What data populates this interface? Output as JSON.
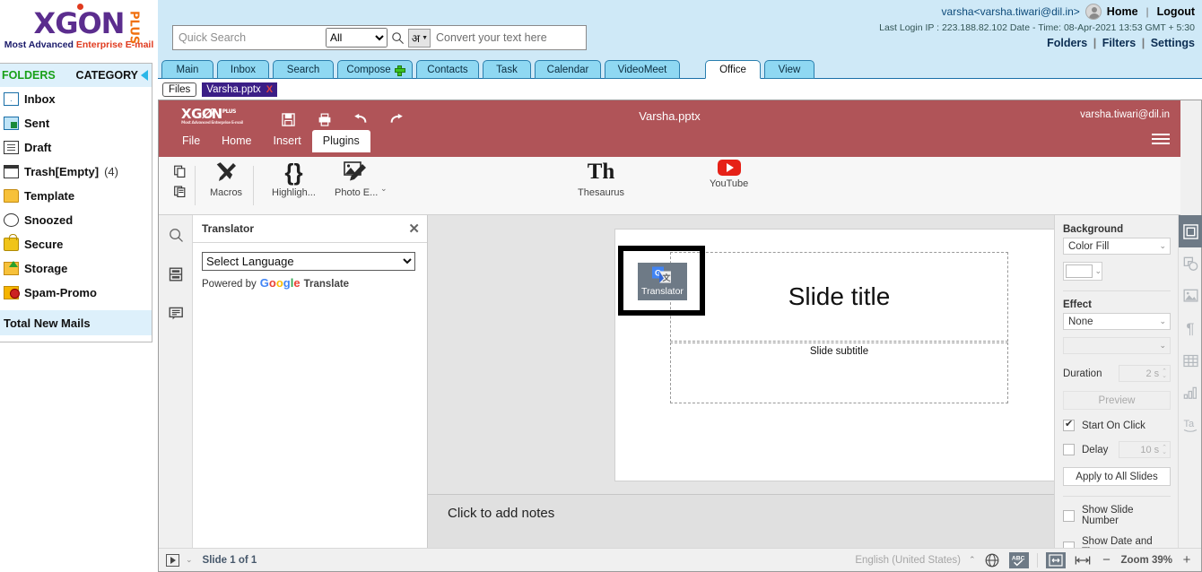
{
  "brand": {
    "logo_text": "XGON",
    "logo_plus": "PLUS",
    "tagline_1": "Most Advanced ",
    "tagline_2": "Enterprise E-mail"
  },
  "search": {
    "query_placeholder": "Quick Search",
    "query_value": "",
    "scope_selected": "All",
    "scope_options": [
      "All"
    ],
    "search_icon": "search-icon",
    "hindi_label": "अ",
    "convert_placeholder": "Convert your text here",
    "convert_value": ""
  },
  "account": {
    "user_display": "varsha<varsha.tiwari@dil.in>",
    "home_label": "Home",
    "logout_label": "Logout",
    "last_login": "Last Login IP : 223.188.82.102 Date - Time: 08-Apr-2021 13:53 GMT + 5:30",
    "folders_label": "Folders",
    "filters_label": "Filters",
    "settings_label": "Settings"
  },
  "main_tabs": [
    {
      "label": "Main",
      "active": false
    },
    {
      "label": "Inbox",
      "active": false
    },
    {
      "label": "Search",
      "active": false
    },
    {
      "label": "Compose",
      "active": false,
      "icon": "plus-icon"
    },
    {
      "label": "Contacts",
      "active": false
    },
    {
      "label": "Task",
      "active": false
    },
    {
      "label": "Calendar",
      "active": false
    },
    {
      "label": "VideoMeet",
      "active": false
    },
    {
      "label": "Office",
      "active": true
    },
    {
      "label": "View",
      "active": false
    }
  ],
  "files_bar": {
    "files_label": "Files",
    "open_file": "Varsha.pptx",
    "close_label": "X"
  },
  "sidebar": {
    "header_folders": "FOLDERS",
    "header_category": "CATEGORY",
    "items": [
      {
        "label": "Inbox",
        "icon": "inbox-icon",
        "count": ""
      },
      {
        "label": "Sent",
        "icon": "sent-icon",
        "count": ""
      },
      {
        "label": "Draft",
        "icon": "draft-icon",
        "count": ""
      },
      {
        "label": "Trash[Empty]",
        "icon": "trash-icon",
        "count": "(4)"
      },
      {
        "label": "Template",
        "icon": "template-icon",
        "count": ""
      },
      {
        "label": "Snoozed",
        "icon": "snoozed-icon",
        "count": ""
      },
      {
        "label": "Secure",
        "icon": "secure-icon",
        "count": ""
      },
      {
        "label": "Storage",
        "icon": "storage-icon",
        "count": ""
      },
      {
        "label": "Spam-Promo",
        "icon": "spam-icon",
        "count": ""
      }
    ],
    "total_new_mails": "Total New Mails"
  },
  "office": {
    "doc_title": "Varsha.pptx",
    "user_email": "varsha.tiwari@dil.in",
    "quick_access": [
      "save-icon",
      "print-icon",
      "undo-icon",
      "redo-icon"
    ],
    "menu_tabs": [
      {
        "label": "File",
        "active": false
      },
      {
        "label": "Home",
        "active": false
      },
      {
        "label": "Insert",
        "active": false
      },
      {
        "label": "Plugins",
        "active": true
      }
    ],
    "ribbon_tools": [
      {
        "label": "Macros",
        "icon": "macros-icon"
      },
      {
        "label": "Highligh...",
        "icon": "highlight-code-icon"
      },
      {
        "label": "Photo E...",
        "icon": "photo-editor-icon",
        "has_caret": true
      },
      {
        "label": "Thesaurus",
        "icon": "thesaurus-icon"
      },
      {
        "label": "Translator",
        "icon": "google-translate-icon",
        "selected": true
      },
      {
        "label": "YouTube",
        "icon": "youtube-icon"
      }
    ],
    "left_rail": [
      "search-icon",
      "slides-icon",
      "comment-icon"
    ],
    "translator_panel": {
      "title": "Translator",
      "close_icon": "close-icon",
      "language_selected": "Select Language",
      "language_options": [
        "Select Language"
      ],
      "powered_by": "Powered by",
      "google_word": "Google",
      "translate_word": "Translate"
    },
    "slide": {
      "title": "Slide title",
      "subtitle": "Slide subtitle"
    },
    "notes_placeholder": "Click to add notes",
    "properties": {
      "background_label": "Background",
      "background_value": "Color Fill",
      "background_color": "#ffffff",
      "effect_label": "Effect",
      "effect_value": "None",
      "effect_sub_value": "",
      "duration_label": "Duration",
      "duration_value": "2 s",
      "preview_label": "Preview",
      "start_on_click_label": "Start On Click",
      "start_on_click_checked": true,
      "delay_label": "Delay",
      "delay_checked": false,
      "delay_value": "10 s",
      "apply_all_label": "Apply to All Slides",
      "show_slide_number_label": "Show Slide Number",
      "show_slide_number_checked": false,
      "show_date_time_label": "Show Date and Time",
      "show_date_time_checked": false
    },
    "right_rail": [
      {
        "icon": "slide-settings-icon",
        "active": true
      },
      {
        "icon": "shape-settings-icon",
        "active": false
      },
      {
        "icon": "image-settings-icon",
        "active": false
      },
      {
        "icon": "paragraph-settings-icon",
        "active": false
      },
      {
        "icon": "table-settings-icon",
        "active": false
      },
      {
        "icon": "chart-settings-icon",
        "active": false
      },
      {
        "icon": "text-art-settings-icon",
        "active": false
      }
    ],
    "status": {
      "play_icon": "start-slideshow-icon",
      "play_caret": "chevron-down-icon",
      "slide_count": "Slide 1 of 1",
      "language": "English (United States)",
      "language_caret": "chevron-up-icon",
      "globe_icon": "set-language-icon",
      "spellcheck_icon": "spellcheck-icon",
      "fit_slide_icon": "fit-to-slide-icon",
      "fit_width_icon": "fit-to-width-icon",
      "zoom_out_label": "−",
      "zoom_label": "Zoom 39%",
      "zoom_in_label": "+"
    }
  }
}
